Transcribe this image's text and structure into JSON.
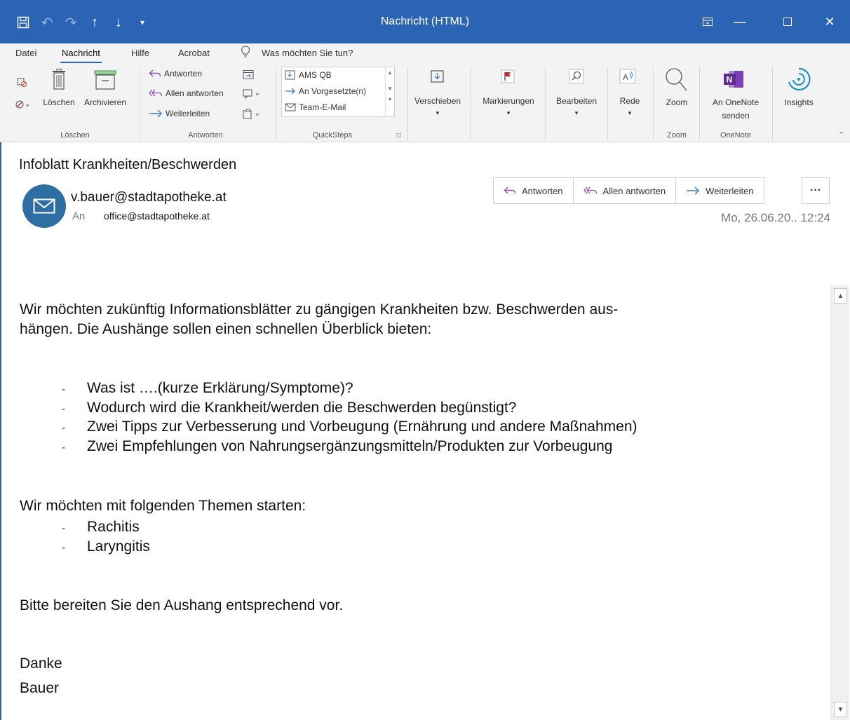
{
  "window": {
    "title": "Nachricht (HTML)"
  },
  "menu": {
    "tabs": [
      "Datei",
      "Nachricht",
      "Hilfe",
      "Acrobat"
    ],
    "search_prompt": "Was möchten Sie tun?"
  },
  "ribbon": {
    "delete_group": {
      "label": "Löschen",
      "delete": "Löschen",
      "archive": "Archivieren"
    },
    "respond_group": {
      "label": "Antworten",
      "reply": "Antworten",
      "reply_all": "Allen antworten",
      "forward": "Weiterleiten"
    },
    "quicksteps_group": {
      "label": "QuickSteps",
      "items": [
        "AMS QB",
        "An Vorgesetzte(n)",
        "Team-E-Mail"
      ]
    },
    "move": "Verschieben",
    "tags": "Markierungen",
    "edit": "Bearbeiten",
    "speech": "Rede",
    "zoom_group": {
      "label": "Zoom",
      "zoom": "Zoom"
    },
    "onenote_group": {
      "label": "OneNote",
      "send_line1": "An OneNote",
      "send_line2": "senden"
    },
    "insights": "Insights"
  },
  "message": {
    "subject": "Infoblatt Krankheiten/Beschwerden",
    "sender": "v.bauer@stadtapotheke.at",
    "to_label": "An",
    "to": "office@stadtapotheke.at",
    "date": "Mo, 26.06.20.. 12:24",
    "actions": {
      "reply": "Antworten",
      "reply_all": "Allen antworten",
      "forward": "Weiterleiten",
      "more": "···"
    }
  },
  "body": {
    "intro": "Wir möchten zukünftig Informationsblätter zu gängigen Krankheiten bzw. Beschwerden aus-hängen. Die Aushänge sollen einen schnellen Überblick bieten:",
    "intro_line1": "Wir möchten zukünftig Informationsblätter zu gängigen Krankheiten bzw. Beschwerden aus-",
    "intro_line2": "hängen. Die Aushänge sollen einen schnellen Überblick bieten:",
    "points": [
      "Was ist ….(kurze Erklärung/Symptome)?",
      "Wodurch wird die Krankheit/werden die Beschwerden begünstigt?",
      "Zwei Tipps zur Verbesserung und Vorbeugung (Ernährung und andere Maßnahmen)",
      "Zwei Empfehlungen von Nahrungsergänzungsmitteln/Produkten zur Vorbeugung"
    ],
    "topics_intro": "Wir möchten mit folgenden Themen starten:",
    "topics": [
      "Rachitis",
      "Laryngitis"
    ],
    "request": "Bitte bereiten Sie den Aushang entsprechend vor.",
    "closing": "Danke",
    "signature": "Bauer"
  },
  "colors": {
    "titlebar": "#2b64b5",
    "avatar": "#2e6fa3",
    "reply_icon": "#8a4fb0",
    "forward_icon": "#3b7fd3",
    "flag": "#c4262e",
    "onenote": "#7b3fb8",
    "insights": "#1a8fc9"
  }
}
